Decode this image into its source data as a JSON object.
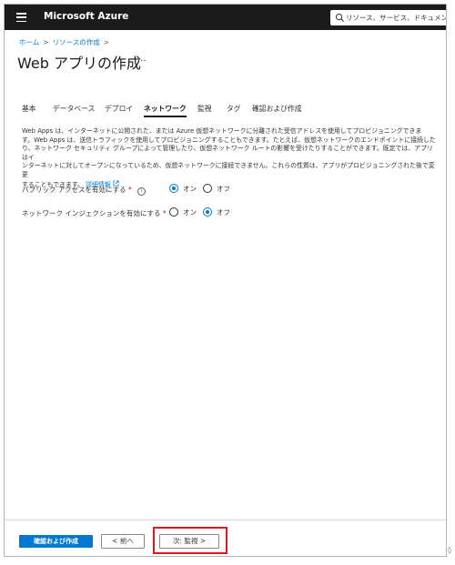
{
  "header": {
    "brand": "Microsoft Azure",
    "search_placeholder": "リソース、サービス、ドキュメントの検"
  },
  "breadcrumb": {
    "items": [
      "ホーム",
      "リソースの作成"
    ]
  },
  "page": {
    "title": "Web アプリの作成",
    "more_label": "···"
  },
  "tabs": [
    {
      "label": "基本"
    },
    {
      "label": "データベース"
    },
    {
      "label": "デプロイ"
    },
    {
      "label": "ネットワーク",
      "active": true
    },
    {
      "label": "監視"
    },
    {
      "label": "タグ"
    },
    {
      "label": "確認および作成"
    }
  ],
  "description": {
    "line1": "Web Apps は、インターネットに公開された、または Azure 仮想ネットワークに分離された受信アドレスを使用してプロビジョニングできま",
    "line2": "す。Web Apps は、送信トラフィックを使用してプロビジョニングすることもできます。たとえば、仮想ネットワークのエンドポイントに接続した",
    "line3": "り、ネットワーク セキュリティ グループによって管理したり、仮想ネットワーク ルートの影響を受けたりすることができます。既定では、アプリはイ",
    "line4": "ンターネットに対してオープンになっているため、仮想ネットワークに接続できません。これらの性質は、アプリがプロビジョニングされた後で変更",
    "line5": "することもできます。",
    "link": "詳細情報"
  },
  "fields": {
    "public_access": {
      "label": "パブリック アクセスを有効にする",
      "required_mark": "*",
      "on_label": "オン",
      "off_label": "オフ",
      "selected": "on"
    },
    "network_injection": {
      "label": "ネットワーク インジェクションを有効にする",
      "required_mark": "*",
      "on_label": "オン",
      "off_label": "オフ",
      "selected": "off"
    }
  },
  "footer": {
    "review_create": "確認および作成",
    "previous": "< 前へ",
    "next": "次: 監視 >"
  },
  "colors": {
    "accent": "#0078d4",
    "topbar": "#1b1b1b",
    "highlight": "#e0141b"
  }
}
